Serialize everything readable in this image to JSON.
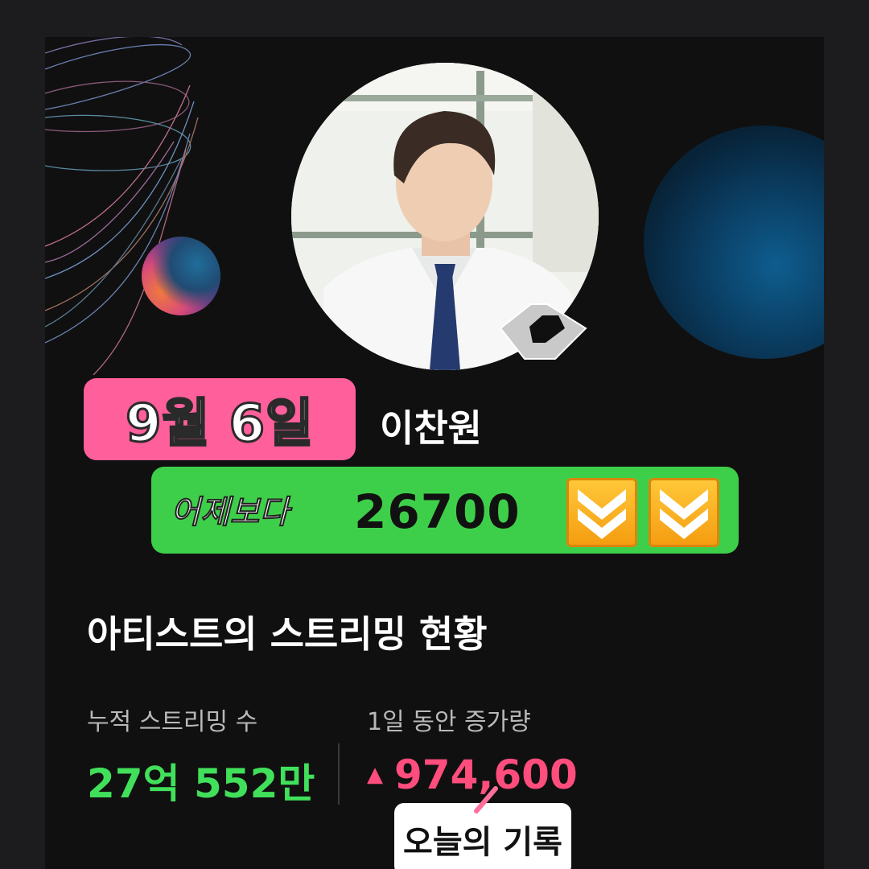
{
  "card": {
    "date_badge": "9월 6일",
    "artist_name": "이찬원",
    "compare": {
      "label": "어제보다",
      "value": "26700",
      "arrows": [
        "double-down-arrow-icon",
        "double-down-arrow-icon"
      ]
    },
    "section_title": "아티스트의 스트리밍 현황",
    "stats": {
      "cumulative_label": "누적 스트리밍 수",
      "cumulative_value": "27억 552만",
      "increase_label": "1일 동안 증가량",
      "increase_value": "974,600",
      "increase_indicator": "▲"
    },
    "record_badge": "오늘의 기록"
  },
  "colors": {
    "background": "#101010",
    "date_pill": "#ff5f9b",
    "compare_pill": "#3ecf4a",
    "cumulative": "#41e05a",
    "increase": "#ff4d7d"
  }
}
